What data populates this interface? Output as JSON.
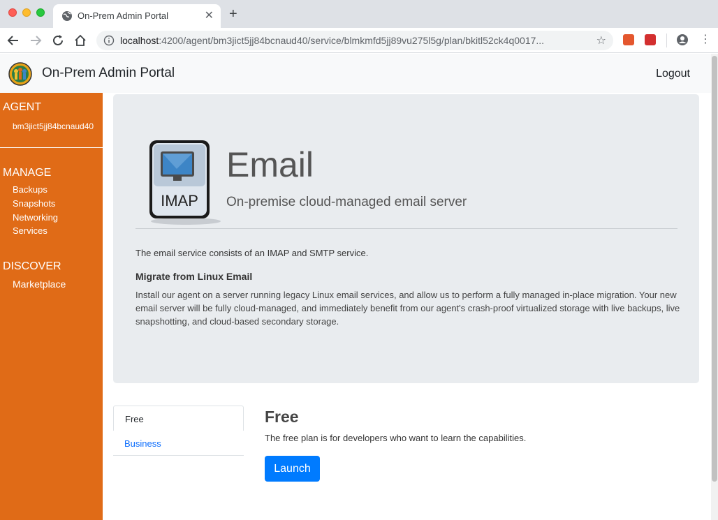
{
  "browser": {
    "tab_title": "On-Prem Admin Portal",
    "url_host": "localhost",
    "url_path": ":4200/agent/bm3jict5jj84bcnaud40/service/blmkmfd5jj89vu275l5g/plan/bkitl52ck4q0017..."
  },
  "header": {
    "brand": "On-Prem Admin Portal",
    "logout": "Logout"
  },
  "sidebar": {
    "agent_heading": "AGENT",
    "agent_id": "bm3jict5jj84bcnaud40",
    "manage_heading": "MANAGE",
    "manage_items": [
      "Backups",
      "Snapshots",
      "Networking",
      "Services"
    ],
    "discover_heading": "DISCOVER",
    "discover_items": [
      "Marketplace"
    ]
  },
  "service": {
    "icon_label": "IMAP",
    "title": "Email",
    "subtitle": "On-premise cloud-managed email server",
    "description": "The email service consists of an IMAP and SMTP service.",
    "migrate_heading": "Migrate from Linux Email",
    "migrate_text": "Install our agent on a server running legacy Linux email services, and allow us to perform a fully managed in-place migration. Your new email server will be fully cloud-managed, and immediately benefit from our agent's crash-proof virtualized storage with live backups, live snapshotting, and cloud-based secondary storage."
  },
  "plans": {
    "items": [
      "Free",
      "Business"
    ],
    "selected_title": "Free",
    "selected_desc": "The free plan is for developers who want to learn the capabilities.",
    "launch_label": "Launch"
  },
  "colors": {
    "sidebar": "#e06b17",
    "primary": "#007bff"
  }
}
